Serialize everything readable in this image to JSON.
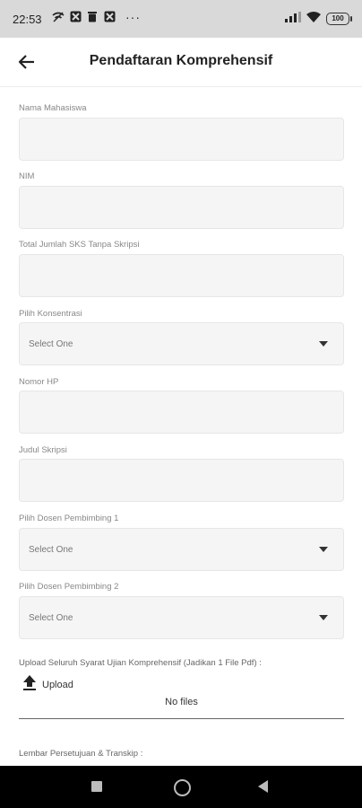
{
  "status_bar": {
    "time": "22:53",
    "battery": "100",
    "icons": [
      "wifi-off-icon",
      "app-icon",
      "trash-icon",
      "app-icon",
      "more-dots-icon",
      "signal-icon",
      "wifi-icon",
      "battery-icon"
    ]
  },
  "app_bar": {
    "title": "Pendaftaran Komprehensif"
  },
  "form": {
    "nama_label": "Nama Mahasiswa",
    "nim_label": "NIM",
    "sks_label": "Total Jumlah SKS Tanpa Skripsi",
    "konsentrasi_label": "Pilih Konsentrasi",
    "konsentrasi_value": "Select One",
    "hp_label": "Nomor HP",
    "judul_label": "Judul Skripsi",
    "dosen1_label": "Pilih Dosen Pembimbing 1",
    "dosen1_value": "Select One",
    "dosen2_label": "Pilih Dosen Pembimbing 2",
    "dosen2_value": "Select One",
    "upload_label": "Upload Seluruh Syarat Ujian Komprehensif (Jadikan 1 File Pdf) :",
    "upload_button": "Upload",
    "no_files": "No files",
    "lembar_label": "Lembar Persetujuan & Transkip :"
  },
  "colors": {
    "status_bar_bg": "#d9d9d9",
    "input_bg": "#f5f5f5",
    "nav_bar_bg": "#000000"
  }
}
